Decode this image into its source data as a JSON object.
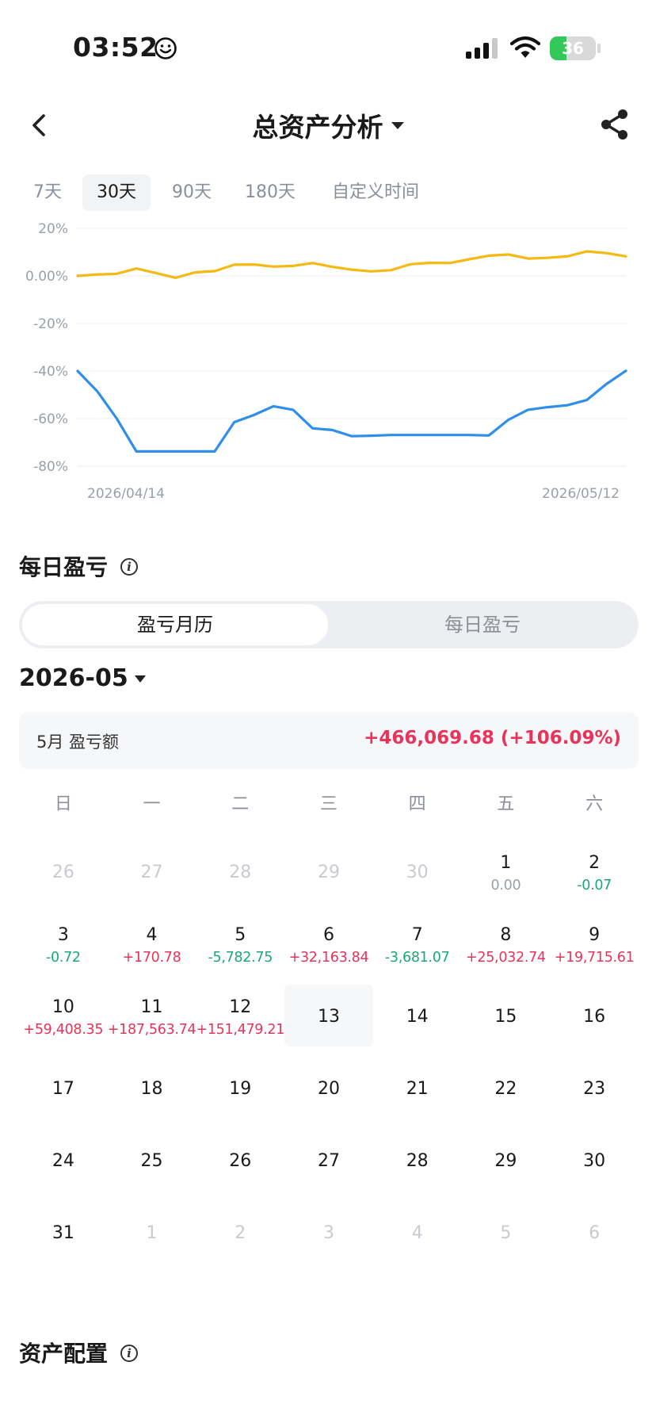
{
  "status_bar": {
    "time": "03:52",
    "battery_level": "36",
    "icons": [
      "smile-icon",
      "signal-icon",
      "wifi-icon",
      "battery-icon"
    ],
    "battery_color": "#34c759"
  },
  "header": {
    "title": "总资产分析",
    "icons": [
      "back-arrow-icon",
      "dropdown-caret-icon",
      "share-icon"
    ]
  },
  "period_tabs": [
    {
      "label": "7天",
      "active": false
    },
    {
      "label": "30天",
      "active": true
    },
    {
      "label": "90天",
      "active": false
    },
    {
      "label": "180天",
      "active": false
    },
    {
      "label": "自定义时间",
      "active": false
    }
  ],
  "chart_data": {
    "type": "line",
    "yticks": [
      "20%",
      "0.00%",
      "-20%",
      "-40%",
      "-60%",
      "-80%"
    ],
    "ylim": [
      -80,
      20
    ],
    "xtick_labels": [
      "2026/04/14",
      "2026/05/12"
    ],
    "grid": true,
    "series": [
      {
        "color": "#f5b914",
        "values": [
          0,
          0.6,
          0.9,
          3.1,
          1.2,
          -0.8,
          1.5,
          2.0,
          4.7,
          4.8,
          3.9,
          4.2,
          5.4,
          3.8,
          2.6,
          1.9,
          2.4,
          4.9,
          5.5,
          5.4,
          7.0,
          8.5,
          9.0,
          7.3,
          7.6,
          8.2,
          10.3,
          9.6,
          8.2
        ]
      },
      {
        "color": "#2f8fe8",
        "values": [
          -40,
          -48.5,
          -60,
          -73.8,
          -73.8,
          -73.8,
          -73.8,
          -73.8,
          -61.5,
          -58.5,
          -54.8,
          -56.3,
          -64.1,
          -64.8,
          -67.4,
          -67.2,
          -66.9,
          -66.9,
          -66.9,
          -66.9,
          -66.9,
          -67.1,
          -60.5,
          -56.3,
          -55.2,
          -54.4,
          -52.2,
          -45.5,
          -39.9
        ]
      }
    ],
    "colors": {
      "gridline": "#eeeeee",
      "tick": "#9aa0a8"
    }
  },
  "daily_pnl": {
    "title": "每日盈亏",
    "segments": [
      {
        "label": "盈亏月历",
        "active": true
      },
      {
        "label": "每日盈亏",
        "active": false
      }
    ],
    "month": "2026-05",
    "summary_label": "5月 盈亏额",
    "summary_value": "+466,069.68 (+106.09%)",
    "colors": {
      "positive": "#e8345a",
      "negative": "#1aa874",
      "neutral": "#9aa0a8"
    },
    "weekdays": [
      "日",
      "一",
      "二",
      "三",
      "四",
      "五",
      "六"
    ],
    "days": [
      {
        "n": "26",
        "other": true,
        "p": ""
      },
      {
        "n": "27",
        "other": true,
        "p": ""
      },
      {
        "n": "28",
        "other": true,
        "p": ""
      },
      {
        "n": "29",
        "other": true,
        "p": ""
      },
      {
        "n": "30",
        "other": true,
        "p": ""
      },
      {
        "n": "1",
        "other": false,
        "p": "0.00"
      },
      {
        "n": "2",
        "other": false,
        "p": "-0.07"
      },
      {
        "n": "3",
        "other": false,
        "p": "-0.72"
      },
      {
        "n": "4",
        "other": false,
        "p": "+170.78"
      },
      {
        "n": "5",
        "other": false,
        "p": "-5,782.75"
      },
      {
        "n": "6",
        "other": false,
        "p": "+32,163.84"
      },
      {
        "n": "7",
        "other": false,
        "p": "-3,681.07"
      },
      {
        "n": "8",
        "other": false,
        "p": "+25,032.74"
      },
      {
        "n": "9",
        "other": false,
        "p": "+19,715.61"
      },
      {
        "n": "10",
        "other": false,
        "p": "+59,408.35"
      },
      {
        "n": "11",
        "other": false,
        "p": "+187,563.74"
      },
      {
        "n": "12",
        "other": false,
        "p": "+151,479.21"
      },
      {
        "n": "13",
        "other": false,
        "p": "",
        "today": true
      },
      {
        "n": "14",
        "other": false,
        "p": ""
      },
      {
        "n": "15",
        "other": false,
        "p": ""
      },
      {
        "n": "16",
        "other": false,
        "p": ""
      },
      {
        "n": "17",
        "other": false,
        "p": ""
      },
      {
        "n": "18",
        "other": false,
        "p": ""
      },
      {
        "n": "19",
        "other": false,
        "p": ""
      },
      {
        "n": "20",
        "other": false,
        "p": ""
      },
      {
        "n": "21",
        "other": false,
        "p": ""
      },
      {
        "n": "22",
        "other": false,
        "p": ""
      },
      {
        "n": "23",
        "other": false,
        "p": ""
      },
      {
        "n": "24",
        "other": false,
        "p": ""
      },
      {
        "n": "25",
        "other": false,
        "p": ""
      },
      {
        "n": "26",
        "other": false,
        "p": ""
      },
      {
        "n": "27",
        "other": false,
        "p": ""
      },
      {
        "n": "28",
        "other": false,
        "p": ""
      },
      {
        "n": "29",
        "other": false,
        "p": ""
      },
      {
        "n": "30",
        "other": false,
        "p": ""
      },
      {
        "n": "31",
        "other": false,
        "p": ""
      },
      {
        "n": "1",
        "other": true,
        "p": ""
      },
      {
        "n": "2",
        "other": true,
        "p": ""
      },
      {
        "n": "3",
        "other": true,
        "p": ""
      },
      {
        "n": "4",
        "other": true,
        "p": ""
      },
      {
        "n": "5",
        "other": true,
        "p": ""
      },
      {
        "n": "6",
        "other": true,
        "p": ""
      }
    ]
  },
  "asset_allocation": {
    "title": "资产配置"
  }
}
